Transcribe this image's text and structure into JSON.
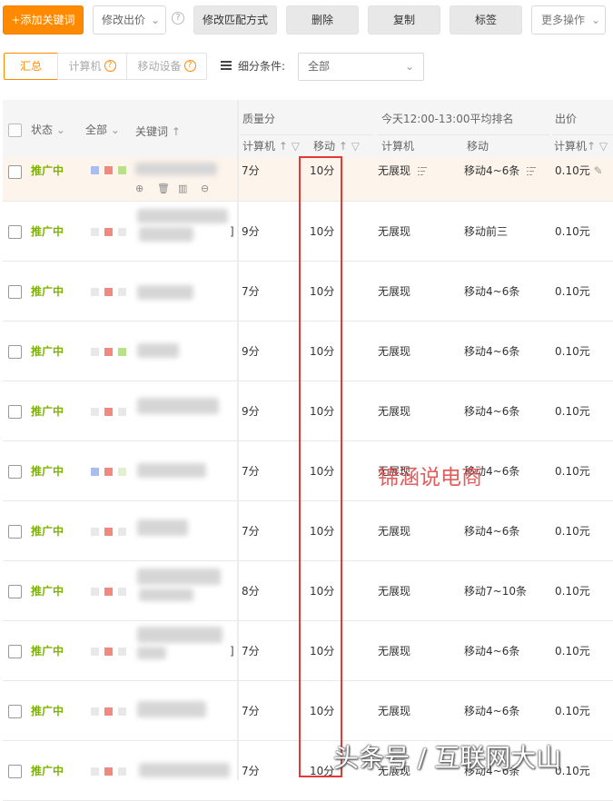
{
  "toolbar": {
    "add_keyword": "+添加关键词",
    "modify_bid": "修改出价",
    "modify_match": "修改匹配方式",
    "delete": "删除",
    "copy": "复制",
    "tag": "标签",
    "more": "更多操作"
  },
  "filters": {
    "summary": "汇总",
    "pc": "计算机",
    "mobile": "移动设备",
    "condition_label": "细分条件:",
    "condition_value": "全部"
  },
  "header": {
    "status": "状态",
    "all": "全部",
    "keyword": "关键词",
    "quality": "质量分",
    "quality_pc": "计算机",
    "quality_mobile": "移动",
    "rank": "今天12:00-13:00平均排名",
    "rank_pc": "计算机",
    "rank_mobile": "移动",
    "bid": "出价",
    "bid_pc": "计算机"
  },
  "rows": [
    {
      "status": "推广中",
      "quality_pc": "7分",
      "quality_mobile": "10分",
      "rank_pc": "无展现",
      "rank_mobile": "移动4~6条",
      "price": "0.10元"
    },
    {
      "status": "推广中",
      "quality_pc": "9分",
      "quality_mobile": "10分",
      "rank_pc": "无展现",
      "rank_mobile": "移动前三",
      "price": "0.10元"
    },
    {
      "status": "推广中",
      "quality_pc": "7分",
      "quality_mobile": "10分",
      "rank_pc": "无展现",
      "rank_mobile": "移动4~6条",
      "price": "0.10元"
    },
    {
      "status": "推广中",
      "quality_pc": "9分",
      "quality_mobile": "10分",
      "rank_pc": "无展现",
      "rank_mobile": "移动4~6条",
      "price": "0.10元"
    },
    {
      "status": "推广中",
      "quality_pc": "9分",
      "quality_mobile": "10分",
      "rank_pc": "无展现",
      "rank_mobile": "移动4~6条",
      "price": "0.10元"
    },
    {
      "status": "推广中",
      "quality_pc": "7分",
      "quality_mobile": "10分",
      "rank_pc": "无展现",
      "rank_mobile": "移动4~6条",
      "price": "0.10元"
    },
    {
      "status": "推广中",
      "quality_pc": "7分",
      "quality_mobile": "10分",
      "rank_pc": "无展现",
      "rank_mobile": "移动4~6条",
      "price": "0.10元"
    },
    {
      "status": "推广中",
      "quality_pc": "8分",
      "quality_mobile": "10分",
      "rank_pc": "无展现",
      "rank_mobile": "移动7~10条",
      "price": "0.10元"
    },
    {
      "status": "推广中",
      "quality_pc": "7分",
      "quality_mobile": "10分",
      "rank_pc": "无展现",
      "rank_mobile": "移动4~6条",
      "price": "0.10元"
    },
    {
      "status": "推广中",
      "quality_pc": "7分",
      "quality_mobile": "10分",
      "rank_pc": "无展现",
      "rank_mobile": "移动4~6条",
      "price": "0.10元"
    },
    {
      "status": "推广中",
      "quality_pc": "7分",
      "quality_mobile": "10分",
      "rank_pc": "无展现",
      "rank_mobile": "移动4~6条",
      "price": "0.10元"
    }
  ],
  "colors": {
    "accent": "#ff8a00",
    "status_green": "#7cb305",
    "highlight_red": "#e53935",
    "tag_blue": "#a9bdf0",
    "tag_red": "#f08a80",
    "tag_green": "#b9e08a"
  },
  "watermarks": {
    "center": "锦涵说电商",
    "bottom": "头条号 / 互联网大山"
  }
}
